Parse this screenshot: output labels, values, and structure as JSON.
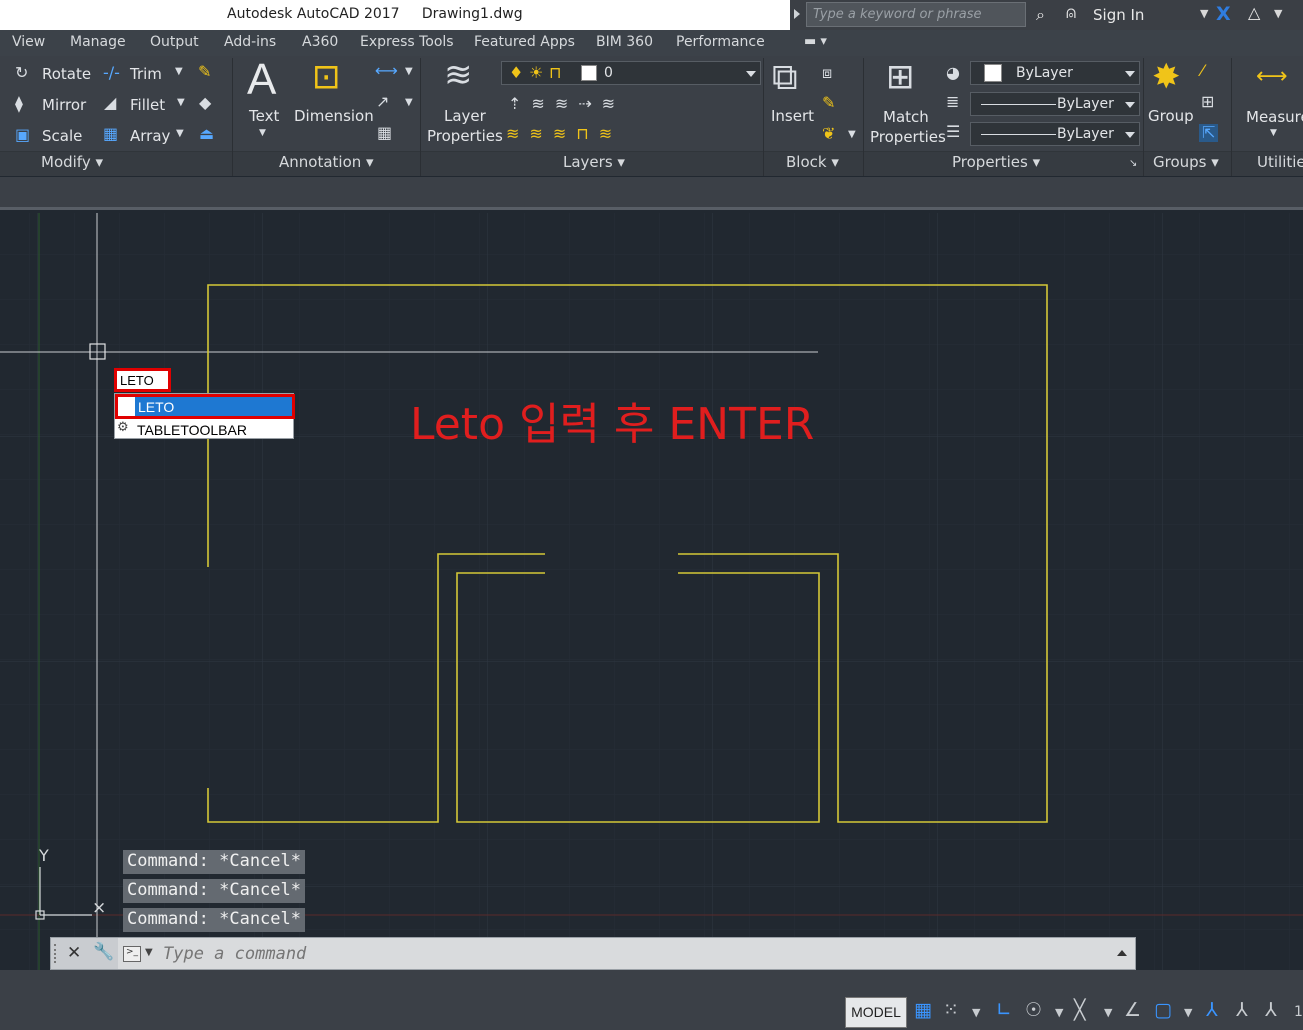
{
  "titlebar": {
    "title": "Autodesk AutoCAD 2017     Drawing1.dwg",
    "search_placeholder": "Type a keyword or phrase",
    "sign_in": "Sign In"
  },
  "menu": [
    "View",
    "Manage",
    "Output",
    "Add-ins",
    "A360",
    "Express Tools",
    "Featured Apps",
    "BIM 360",
    "Performance"
  ],
  "ribbon": {
    "modify": {
      "rotate": "Rotate",
      "trim": "Trim",
      "mirror": "Mirror",
      "fillet": "Fillet",
      "scale": "Scale",
      "array": "Array",
      "footer": "Modify"
    },
    "annotation": {
      "text": "Text",
      "dimension": "Dimension",
      "footer": "Annotation"
    },
    "layers": {
      "layer_label_1": "Layer",
      "layer_label_2": "Properties",
      "current_layer": "0",
      "footer": "Layers"
    },
    "block": {
      "insert": "Insert",
      "footer": "Block"
    },
    "properties": {
      "match_1": "Match",
      "match_2": "Properties",
      "color": "ByLayer",
      "lineweight": "ByLayer",
      "linetype": "ByLayer",
      "footer": "Properties"
    },
    "groups": {
      "group": "Group",
      "footer": "Groups"
    },
    "utilities": {
      "measure": "Measure",
      "footer": "Utilitie"
    }
  },
  "autocomplete": {
    "typed": "LETO",
    "items": [
      "LETO",
      "TABLETOOLBAR"
    ]
  },
  "annotation_text": "Leto 입력 후 ENTER",
  "ucs": {
    "y_label": "Y"
  },
  "command_history": [
    "Command: *Cancel*",
    "Command: *Cancel*",
    "Command: *Cancel*"
  ],
  "command_line": {
    "placeholder": "Type a command"
  },
  "status": {
    "model": "MODEL",
    "trailing": "1"
  },
  "colors": {
    "canvas": "#212830",
    "geometry": "#d4c737",
    "highlight": "#e00000",
    "selection": "#1e78d2"
  }
}
